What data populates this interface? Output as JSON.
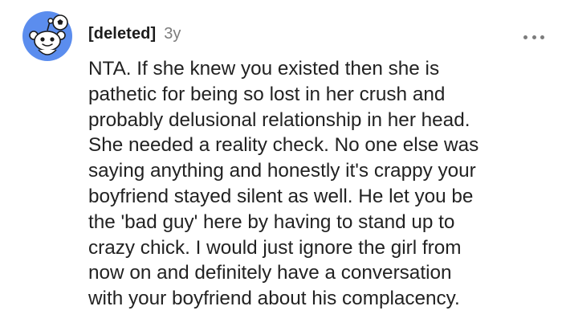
{
  "comment": {
    "author": "[deleted]",
    "age": "3y",
    "avatar_icon": "reddit-snoo-soccer-icon",
    "more_icon": "more-options-icon",
    "body_lines": [
      "NTA. If she knew you existed then she is",
      "pathetic for being so lost in her crush and",
      "probably delusional relationship in her head.",
      "She needed a reality check. No one else was",
      "saying anything and honestly it's crappy your",
      "boyfriend stayed silent as well. He let you be",
      "the 'bad guy' here by having to stand up to",
      "crazy chick. I would just ignore the girl from",
      "now on and definitely have a conversation",
      "with your boyfriend about his complacency."
    ]
  },
  "colors": {
    "avatar_bg": "#5b8dee",
    "username": "#1c1c1c",
    "meta": "#7c7c7c",
    "text": "#222222"
  }
}
